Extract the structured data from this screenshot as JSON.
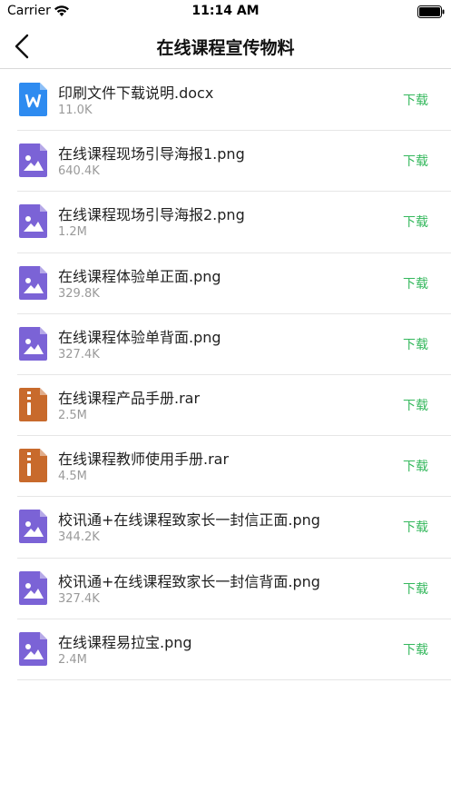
{
  "status": {
    "carrier": "Carrier",
    "time": "11:14 AM"
  },
  "nav": {
    "title": "在线课程宣传物料",
    "back_icon": "chevron-left-icon"
  },
  "colors": {
    "accent_green": "#35b85d",
    "word_blue": "#2e8bf0",
    "image_purple": "#7b63d6",
    "archive_orange": "#c86a2c"
  },
  "files": [
    {
      "name": "印刷文件下载说明.docx",
      "size": "11.0K",
      "icon": "word-doc-icon",
      "action": "下载"
    },
    {
      "name": "在线课程现场引导海报1.png",
      "size": "640.4K",
      "icon": "image-file-icon",
      "action": "下载"
    },
    {
      "name": "在线课程现场引导海报2.png",
      "size": "1.2M",
      "icon": "image-file-icon",
      "action": "下载"
    },
    {
      "name": "在线课程体验单正面.png",
      "size": "329.8K",
      "icon": "image-file-icon",
      "action": "下载"
    },
    {
      "name": "在线课程体验单背面.png",
      "size": "327.4K",
      "icon": "image-file-icon",
      "action": "下载"
    },
    {
      "name": "在线课程产品手册.rar",
      "size": "2.5M",
      "icon": "archive-file-icon",
      "action": "下载"
    },
    {
      "name": "在线课程教师使用手册.rar",
      "size": "4.5M",
      "icon": "archive-file-icon",
      "action": "下载"
    },
    {
      "name": "校讯通+在线课程致家长一封信正面.png",
      "size": "344.2K",
      "icon": "image-file-icon",
      "action": "下载"
    },
    {
      "name": "校讯通+在线课程致家长一封信背面.png",
      "size": "327.4K",
      "icon": "image-file-icon",
      "action": "下载"
    },
    {
      "name": "在线课程易拉宝.png",
      "size": "2.4M",
      "icon": "image-file-icon",
      "action": "下载"
    }
  ]
}
